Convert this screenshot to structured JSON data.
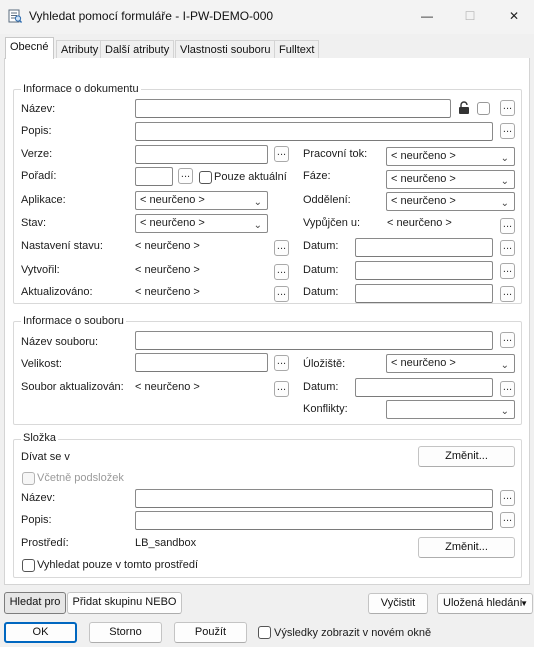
{
  "window": {
    "title": "Vyhledat pomocí formuláře - I-PW-DEMO-000",
    "app_icon": "form-search-icon",
    "controls": {
      "minimize": "—",
      "maximize": "☐",
      "close": "✕"
    }
  },
  "tabs": [
    {
      "label": "Obecné",
      "active": true
    },
    {
      "label": "Atributy"
    },
    {
      "label": "Další atributy"
    },
    {
      "label": "Vlastnosti souboru"
    },
    {
      "label": "Fulltext"
    }
  ],
  "doc_group": {
    "legend": "Informace o dokumentu",
    "nazev": {
      "label": "Název:",
      "value": ""
    },
    "popis": {
      "label": "Popis:",
      "value": ""
    },
    "verze": {
      "label": "Verze:",
      "value": ""
    },
    "poradi": {
      "label": "Pořadí:",
      "value": "",
      "only_current": "Pouze aktuální"
    },
    "aplikace": {
      "label": "Aplikace:",
      "value": "< neurčeno >"
    },
    "stav": {
      "label": "Stav:",
      "value": "< neurčeno >"
    },
    "nastaveni_stavu": {
      "label": "Nastavení stavu:",
      "value": "< neurčeno >"
    },
    "vytvoril": {
      "label": "Vytvořil:",
      "value": "< neurčeno >"
    },
    "aktualizovano": {
      "label": "Aktualizováno:",
      "value": "< neurčeno >"
    },
    "pracovni_tok": {
      "label": "Pracovní tok:",
      "value": "< neurčeno >"
    },
    "faze": {
      "label": "Fáze:",
      "value": "< neurčeno >"
    },
    "oddeleni": {
      "label": "Oddělení:",
      "value": "< neurčeno >"
    },
    "vypujcen": {
      "label": "Vypůjčen u:",
      "value": "< neurčeno >"
    },
    "datum_label": "Datum:"
  },
  "file_group": {
    "legend": "Informace o souboru",
    "nazev_souboru": {
      "label": "Název souboru:",
      "value": ""
    },
    "velikost": {
      "label": "Velikost:",
      "value": ""
    },
    "uloziste": {
      "label": "Úložiště:",
      "value": "< neurčeno >"
    },
    "aktualizovan": {
      "label": "Soubor aktualizován:",
      "value": "< neurčeno >"
    },
    "datum": {
      "label": "Datum:",
      "value": ""
    },
    "konflikty": {
      "label": "Konflikty:",
      "value": ""
    }
  },
  "folder_group": {
    "legend": "Složka",
    "divat_se_v": "Dívat se v",
    "zmenit_1": "Změnit...",
    "vcetne_podslozek": "Včetně podsložek",
    "nazev": {
      "label": "Název:",
      "value": ""
    },
    "popis": {
      "label": "Popis:",
      "value": ""
    },
    "prostredi": {
      "label": "Prostředí:",
      "value": "LB_sandbox"
    },
    "zmenit_2": "Změnit...",
    "only_env": "Vyhledat pouze v tomto prostředí"
  },
  "ellipsis": "...",
  "bottom": {
    "hledat_pro": "Hledat pro",
    "pridat_skupinu": "Přidat skupinu NEBO",
    "vycistit": "Vyčistit",
    "ulozena_hledani": "Uložená hledání",
    "ok": "OK",
    "storno": "Storno",
    "pouzit": "Použít",
    "new_window": "Výsledky zobrazit v novém okně"
  }
}
